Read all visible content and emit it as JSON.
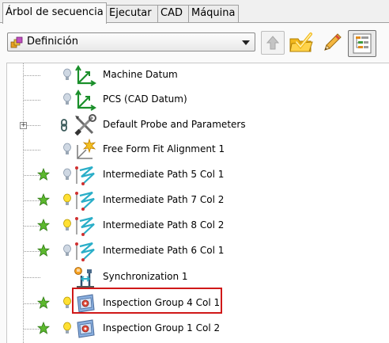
{
  "tabs": [
    {
      "label": "Árbol de secuencia",
      "active": true
    },
    {
      "label": "Ejecutar",
      "active": false
    },
    {
      "label": "CAD",
      "active": false
    },
    {
      "label": "Máquina",
      "active": false
    }
  ],
  "toolbar": {
    "view_select": {
      "value": "Definición",
      "icon": "definition-icon"
    }
  },
  "tree": {
    "items": [
      {
        "label": "Machine Datum",
        "icon": "datum-axes-icon",
        "bulb": "grey",
        "star": false,
        "expander": false
      },
      {
        "label": "PCS (CAD Datum)",
        "icon": "datum-axes-icon",
        "bulb": "grey",
        "star": false,
        "expander": false
      },
      {
        "label": "Default Probe and Parameters",
        "icon": "tools-icon",
        "bulb": "chain",
        "star": false,
        "expander": true
      },
      {
        "label": "Free Form Fit Alignment 1",
        "icon": "alignment-icon",
        "bulb": "grey",
        "star": false,
        "expander": false
      },
      {
        "label": "Intermediate Path 5 Col 1",
        "icon": "path-icon",
        "bulb": "grey",
        "star": true,
        "expander": false
      },
      {
        "label": "Intermediate Path 7 Col 2",
        "icon": "path-icon",
        "bulb": "yellow",
        "star": true,
        "expander": false
      },
      {
        "label": "Intermediate Path 8 Col 2",
        "icon": "path-icon",
        "bulb": "yellow",
        "star": true,
        "expander": false
      },
      {
        "label": "Intermediate Path 6 Col 1",
        "icon": "path-icon",
        "bulb": "grey",
        "star": true,
        "expander": false
      },
      {
        "label": "Synchronization 1",
        "icon": "synchronization-icon",
        "bulb": "none",
        "star": false,
        "expander": false,
        "highlighted": true
      },
      {
        "label": "Inspection Group 4 Col 1",
        "icon": "inspection-group-icon",
        "bulb": "yellow",
        "star": true,
        "expander": false
      },
      {
        "label": "Inspection Group 1 Col 2",
        "icon": "inspection-group-icon",
        "bulb": "yellow",
        "star": true,
        "expander": false
      }
    ]
  },
  "colors": {
    "highlight": "#d01818",
    "star": "#5cb82e",
    "bulb_yellow": "#ffe033",
    "bulb_grey": "#cfd8e3",
    "datum_green": "#1a8f2a"
  }
}
